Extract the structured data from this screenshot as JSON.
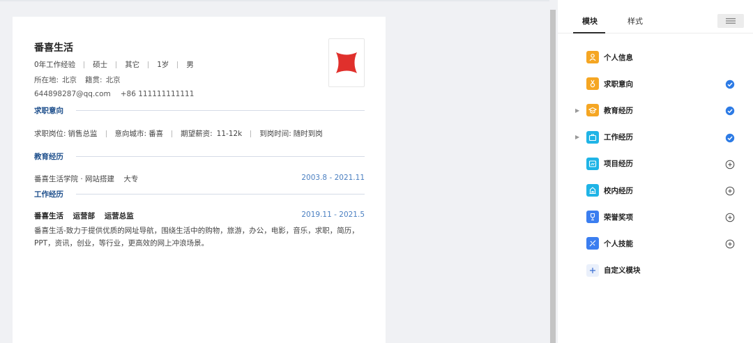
{
  "resume": {
    "name": "番喜生活",
    "basic": [
      "0年工作经验",
      "硕士",
      "其它",
      "1岁",
      "男"
    ],
    "location_label": "所在地:",
    "location": "北京",
    "origin_label": "籍贯:",
    "origin": "北京",
    "email": "644898287@qq.com",
    "phone": "+86 111111111111",
    "sections": {
      "intention": {
        "title": "求职意向",
        "items": [
          {
            "label": "求职岗位:",
            "value": "销售总监"
          },
          {
            "label": "意向城市:",
            "value": "番喜"
          },
          {
            "label": "期望薪资:",
            "value": "11-12k"
          },
          {
            "label": "到岗时间:",
            "value": "随时到岗"
          }
        ]
      },
      "education": {
        "title": "教育经历",
        "school": "番喜生活学院 · 网站搭建",
        "degree": "大专",
        "date": "2003.8 - 2021.11"
      },
      "work": {
        "title": "工作经历",
        "company": "番喜生活",
        "department": "运营部",
        "position": "运营总监",
        "date": "2019.11 - 2021.5",
        "description": "番喜生活-致力于提供优质的网址导航，围绕生活中的购物，旅游，办公，电影，音乐，求职，简历，PPT，资讯，创业，等行业，更高效的网上冲浪场景。"
      }
    }
  },
  "panel": {
    "tabs": [
      "模块",
      "样式"
    ],
    "modules": [
      {
        "label": "个人信息",
        "icon": "person-icon",
        "color": "#f5a623",
        "status": "none",
        "caret": false
      },
      {
        "label": "求职意向",
        "icon": "medal-icon",
        "color": "#f5a623",
        "status": "checked",
        "caret": false
      },
      {
        "label": "教育经历",
        "icon": "graduation-cap-icon",
        "color": "#f5a623",
        "status": "checked",
        "caret": true
      },
      {
        "label": "工作经历",
        "icon": "briefcase-icon",
        "color": "#1fb4e6",
        "status": "checked",
        "caret": true
      },
      {
        "label": "项目经历",
        "icon": "project-icon",
        "color": "#1fb4e6",
        "status": "add",
        "caret": false
      },
      {
        "label": "校内经历",
        "icon": "school-icon",
        "color": "#1fb4e6",
        "status": "add",
        "caret": false
      },
      {
        "label": "荣誉奖项",
        "icon": "trophy-icon",
        "color": "#3b7ef0",
        "status": "add",
        "caret": false
      },
      {
        "label": "个人技能",
        "icon": "skill-icon",
        "color": "#3b7ef0",
        "status": "add",
        "caret": false
      },
      {
        "label": "自定义模块",
        "icon": "plus-icon",
        "color": "#eaf0fb",
        "status": "none",
        "caret": false
      }
    ],
    "colors": {
      "check": "#2d7be5",
      "active_tab": "#2c2c2c"
    }
  }
}
